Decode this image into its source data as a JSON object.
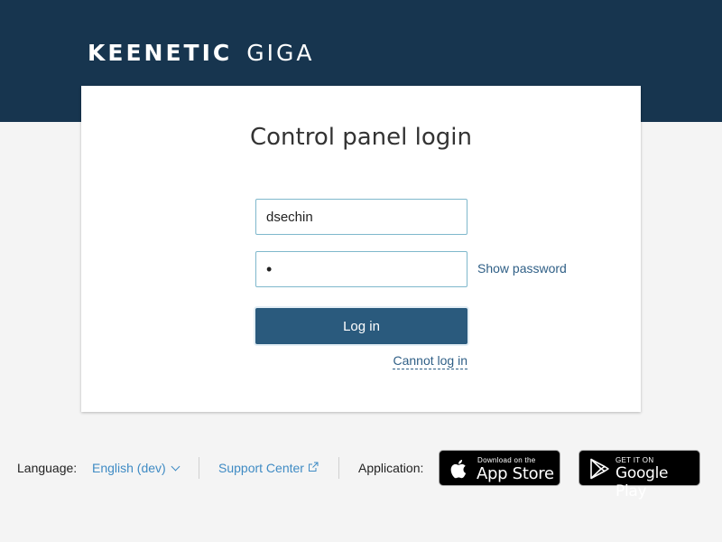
{
  "header": {
    "brand": "KEENETIC",
    "model": "GIGA",
    "colors": {
      "band": "#17354f"
    }
  },
  "login": {
    "title": "Control panel login",
    "username_value": "dsechin",
    "password_mask": "•",
    "show_password_label": "Show password",
    "login_button_label": "Log in",
    "cannot_login_label": "Cannot log in",
    "colors": {
      "button": "#2a5a7d",
      "link": "#2f5f86"
    }
  },
  "footer": {
    "language_label": "Language:",
    "language_value": "English (dev)",
    "language_icon": "chevron-down-icon",
    "support_label": "Support Center",
    "support_icon": "external-link-icon",
    "application_label": "Application:",
    "appstore": {
      "small": "Download on the",
      "big": "App Store",
      "icon": "apple-icon"
    },
    "googleplay": {
      "small": "GET IT ON",
      "big": "Google Play",
      "icon": "google-play-icon"
    },
    "colors": {
      "link": "#3f8bc4"
    }
  }
}
